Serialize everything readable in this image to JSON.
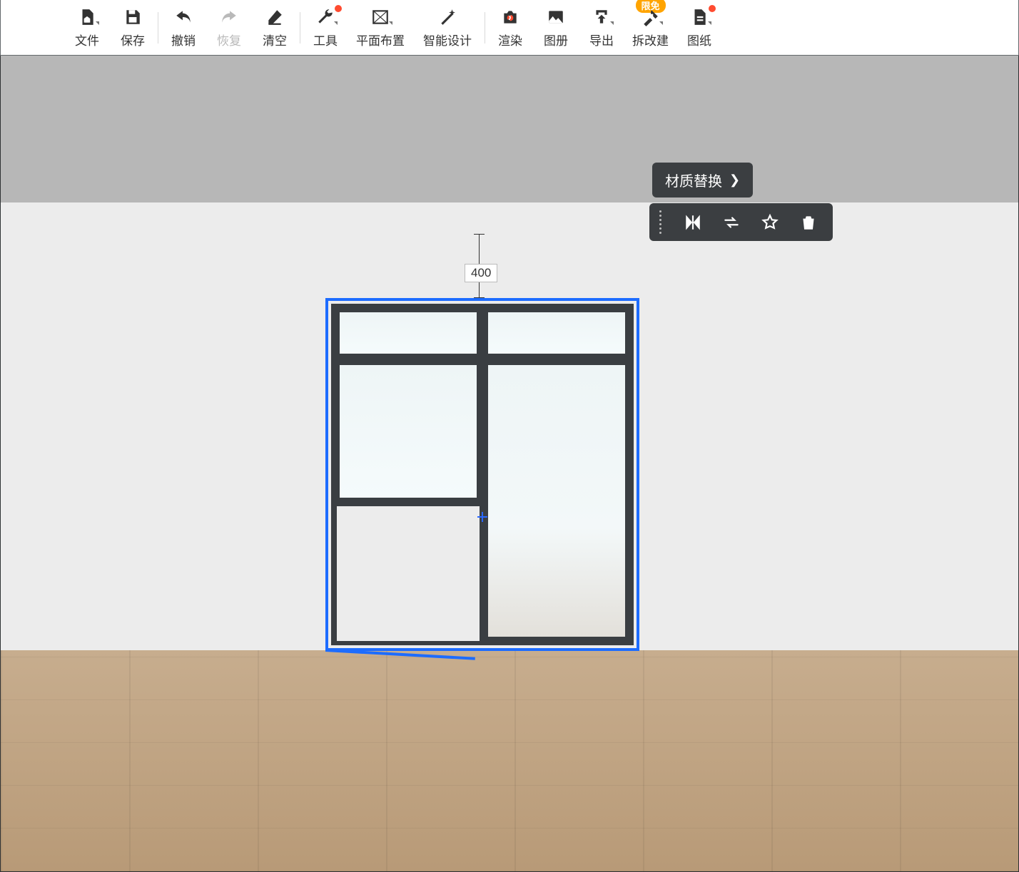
{
  "toolbar": {
    "file": "文件",
    "save": "保存",
    "undo": "撤销",
    "redo": "恢复",
    "clear": "清空",
    "tools": "工具",
    "layout": "平面布置",
    "smart": "智能设计",
    "render": "渲染",
    "album": "图册",
    "export": "导出",
    "rebuild": "拆改建",
    "drawings": "图纸",
    "badge_free": "限免"
  },
  "measurement": {
    "top_gap": "400"
  },
  "context_menu": {
    "replace_material": "材质替换"
  }
}
